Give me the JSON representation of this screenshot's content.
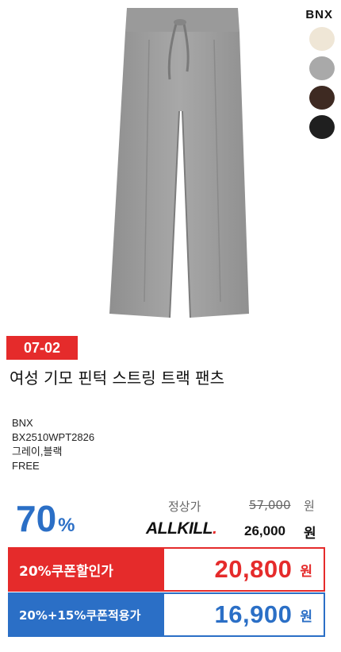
{
  "brand_logo": "BNX",
  "swatches": [
    {
      "name": "ivory",
      "color": "#efe6d6"
    },
    {
      "name": "gray",
      "color": "#a9a9a9"
    },
    {
      "name": "brown",
      "color": "#3e2a22"
    },
    {
      "name": "black",
      "color": "#1f1f1f"
    }
  ],
  "product_image": {
    "subject": "gray fleece wide track pants",
    "color": "#9e9e9e"
  },
  "tag": "07-02",
  "title": "여성 기모 핀턱 스트링 트랙 팬츠",
  "info": {
    "brand": "BNX",
    "code": "BX2510WPT2826",
    "colors": "그레이,블랙",
    "size": "FREE"
  },
  "discount": {
    "number": "70",
    "unit": "%"
  },
  "regular": {
    "label": "정상가",
    "price": "57,000",
    "unit": "원"
  },
  "allkill": {
    "logo_text": "ALLKILL",
    "logo_dot": ".",
    "price": "26,000",
    "unit": "원"
  },
  "coupons": [
    {
      "label": "20%쿠폰할인가",
      "price": "20,800",
      "unit": "원",
      "color": "#e52b2b"
    },
    {
      "label": "20%+15%쿠폰적용가",
      "price": "16,900",
      "unit": "원",
      "color": "#2b6fc6"
    }
  ]
}
